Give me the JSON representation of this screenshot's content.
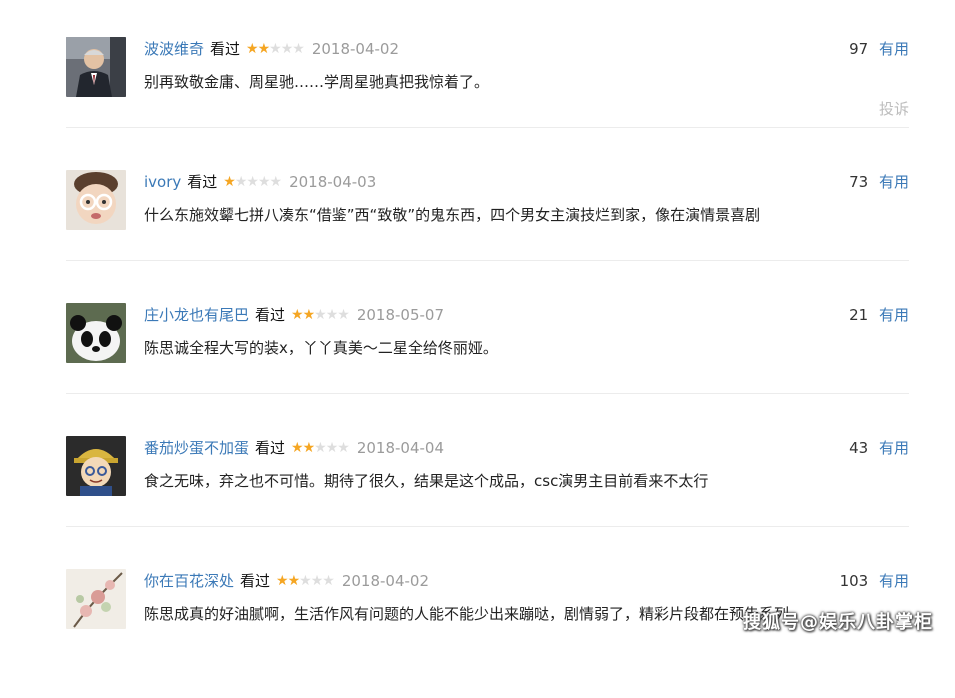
{
  "reviews": [
    {
      "user": "波波维奇",
      "status": "看过",
      "rating": 2,
      "date": "2018-04-02",
      "votes": "97",
      "useful_label": "有用",
      "comment": "别再致敬金庸、周星驰……学周星驰真把我惊着了。",
      "report_label": "投诉",
      "avatar_icon": "man-in-suit-avatar"
    },
    {
      "user": "ivory",
      "status": "看过",
      "rating": 1,
      "date": "2018-04-03",
      "votes": "73",
      "useful_label": "有用",
      "comment": "什么东施效颦七拼八凑东“借鉴”西“致敬”的鬼东西，四个男女主演技烂到家，像在演情景喜剧",
      "avatar_icon": "baby-with-glasses-avatar"
    },
    {
      "user": "庄小龙也有尾巴",
      "status": "看过",
      "rating": 2,
      "date": "2018-05-07",
      "votes": "21",
      "useful_label": "有用",
      "comment": "陈思诚全程大写的装x，丫丫真美～二星全给佟丽娅。",
      "avatar_icon": "panda-avatar"
    },
    {
      "user": "番茄炒蛋不加蛋",
      "status": "看过",
      "rating": 2,
      "date": "2018-04-04",
      "votes": "43",
      "useful_label": "有用",
      "comment": "食之无味，弃之也不可惜。期待了很久，结果是这个成品，csc演男主目前看来不太行",
      "avatar_icon": "cartoon-boy-avatar"
    },
    {
      "user": "你在百花深处",
      "status": "看过",
      "rating": 2,
      "date": "2018-04-02",
      "votes": "103",
      "useful_label": "有用",
      "comment": "陈思成真的好油腻啊，生活作风有问题的人能不能少出来蹦哒，剧情弱了，精彩片段都在预告系列",
      "avatar_icon": "flower-branch-avatar"
    }
  ],
  "watermark": "搜狐号@娱乐八卦掌柜",
  "colors": {
    "link": "#3b79b7",
    "star_on": "#f5a623",
    "star_off": "#dedede",
    "date": "#9b9b9b"
  }
}
